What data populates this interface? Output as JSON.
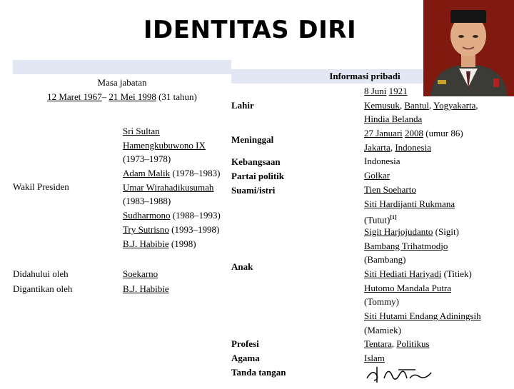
{
  "title": "IDENTITAS DIRI",
  "left": {
    "term_label": "Masa jabatan",
    "term_start": "12 Maret 1967",
    "term_sep": "– ",
    "term_end": "21 Mei 1998",
    "term_duration": " (31 tahun)",
    "vp_label": "Wakil Presiden",
    "vp_lines": [
      {
        "text": "Sri Sultan",
        "link": true,
        "suffix": ""
      },
      {
        "text": "Hamengkubuwono IX",
        "link": true,
        "suffix": ""
      },
      {
        "text": "",
        "link": false,
        "suffix": "(1973–1978)"
      },
      {
        "text": "Adam Malik",
        "link": true,
        "suffix": " (1978–1983)"
      },
      {
        "text": "Umar Wirahadikusumah",
        "link": true,
        "suffix": ""
      },
      {
        "text": "",
        "link": false,
        "suffix": "(1983–1988)"
      },
      {
        "text": "Sudharmono",
        "link": true,
        "suffix": " (1988–1993)"
      },
      {
        "text": "Try Sutrisno",
        "link": true,
        "suffix": " (1993–1998)"
      },
      {
        "text": "B.J. Habibie",
        "link": true,
        "suffix": " (1998)"
      }
    ],
    "preceded_label": "Didahului oleh",
    "preceded_value": "Soekarno",
    "succeeded_label": "Digantikan oleh",
    "succeeded_value": "B.J. Habibie"
  },
  "right": {
    "header": "Informasi pribadi",
    "labels": {
      "born": "Lahir",
      "died": "Meninggal",
      "nationality": "Kebangsaan",
      "party": "Partai politik",
      "spouse": "Suami/istri",
      "children": "Anak",
      "profession": "Profesi",
      "religion": "Agama",
      "signature": "Tanda tangan"
    },
    "values": [
      [
        {
          "t": "8 Juni",
          "l": true
        },
        {
          "t": " ",
          "l": false
        },
        {
          "t": "1921",
          "l": true
        }
      ],
      [
        {
          "t": "Kemusuk",
          "l": true
        },
        {
          "t": ", ",
          "l": false
        },
        {
          "t": "Bantul",
          "l": true
        },
        {
          "t": ", ",
          "l": false
        },
        {
          "t": "Yogyakarta",
          "l": true
        },
        {
          "t": ",",
          "l": false
        }
      ],
      [
        {
          "t": "Hindia Belanda",
          "l": true
        }
      ],
      [
        {
          "t": "27 Januari",
          "l": true
        },
        {
          "t": " ",
          "l": false
        },
        {
          "t": "2008",
          "l": true
        },
        {
          "t": " (umur 86)",
          "l": false
        }
      ],
      [
        {
          "t": "Jakarta",
          "l": true
        },
        {
          "t": ", ",
          "l": false
        },
        {
          "t": "Indonesia",
          "l": true
        }
      ],
      [
        {
          "t": "Indonesia",
          "l": false
        }
      ],
      [
        {
          "t": "Golkar",
          "l": true
        }
      ],
      [
        {
          "t": "Tien Soeharto",
          "l": true
        }
      ],
      [
        {
          "t": "Siti Hardijanti Rukmana",
          "l": true
        }
      ],
      [
        {
          "t": "(Tutut)",
          "l": false
        },
        {
          "t": "[1]",
          "l": true,
          "sup": true
        }
      ],
      [
        {
          "t": "Sigit Harjojudanto",
          "l": true
        },
        {
          "t": " (Sigit)",
          "l": false
        }
      ],
      [
        {
          "t": "Bambang Trihatmodjo",
          "l": true
        }
      ],
      [
        {
          "t": "(Bambang)",
          "l": false
        }
      ],
      [
        {
          "t": "Siti Hediati Hariyadi",
          "l": true
        },
        {
          "t": " (Titiek)",
          "l": false
        }
      ],
      [
        {
          "t": "Hutomo Mandala Putra",
          "l": true
        }
      ],
      [
        {
          "t": "(Tommy)",
          "l": false
        }
      ],
      [
        {
          "t": "Siti Hutami Endang Adiningsih",
          "l": true
        }
      ],
      [
        {
          "t": "(Mamiek)",
          "l": false
        }
      ],
      [
        {
          "t": "Tentara",
          "l": true
        },
        {
          "t": ", ",
          "l": false
        },
        {
          "t": "Politikus",
          "l": true
        }
      ],
      [
        {
          "t": "Islam",
          "l": true
        }
      ]
    ]
  }
}
